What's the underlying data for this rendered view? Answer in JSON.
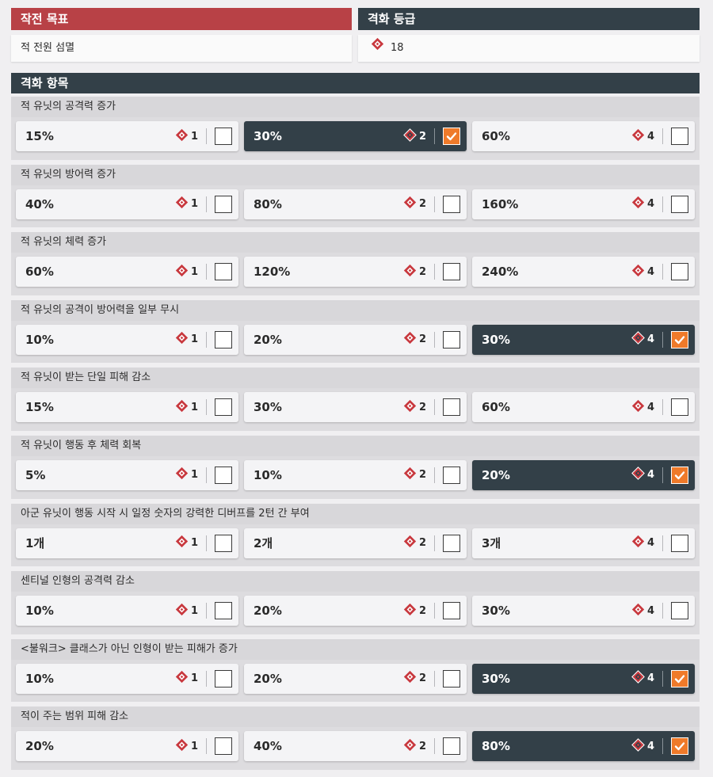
{
  "objective": {
    "header": "작전 목표",
    "value": "적 전원 섬멸"
  },
  "grade": {
    "header": "격화 등급",
    "value": "18",
    "icon": "diamond-arrow-icon"
  },
  "modifiers_header": "격화 항목",
  "colors": {
    "accent_red": "#b84146",
    "dark": "#334048",
    "check": "#ef7a2a",
    "icon_red": "#c8383e"
  },
  "modifiers": [
    {
      "title": "적 유닛의 공격력 증가",
      "options": [
        {
          "value": "15%",
          "cost": "1",
          "checked": false
        },
        {
          "value": "30%",
          "cost": "2",
          "checked": true
        },
        {
          "value": "60%",
          "cost": "4",
          "checked": false
        }
      ]
    },
    {
      "title": "적 유닛의 방어력 증가",
      "options": [
        {
          "value": "40%",
          "cost": "1",
          "checked": false
        },
        {
          "value": "80%",
          "cost": "2",
          "checked": false
        },
        {
          "value": "160%",
          "cost": "4",
          "checked": false
        }
      ]
    },
    {
      "title": "적 유닛의 체력 증가",
      "options": [
        {
          "value": "60%",
          "cost": "1",
          "checked": false
        },
        {
          "value": "120%",
          "cost": "2",
          "checked": false
        },
        {
          "value": "240%",
          "cost": "4",
          "checked": false
        }
      ]
    },
    {
      "title": "적 유닛의 공격이 방어력을 일부 무시",
      "options": [
        {
          "value": "10%",
          "cost": "1",
          "checked": false
        },
        {
          "value": "20%",
          "cost": "2",
          "checked": false
        },
        {
          "value": "30%",
          "cost": "4",
          "checked": true
        }
      ]
    },
    {
      "title": "적 유닛이 받는 단일 피해 감소",
      "options": [
        {
          "value": "15%",
          "cost": "1",
          "checked": false
        },
        {
          "value": "30%",
          "cost": "2",
          "checked": false
        },
        {
          "value": "60%",
          "cost": "4",
          "checked": false
        }
      ]
    },
    {
      "title": "적 유닛이 행동 후 체력 회복",
      "options": [
        {
          "value": "5%",
          "cost": "1",
          "checked": false
        },
        {
          "value": "10%",
          "cost": "2",
          "checked": false
        },
        {
          "value": "20%",
          "cost": "4",
          "checked": true
        }
      ]
    },
    {
      "title": "아군 유닛이 행동 시작 시 일정 숫자의 강력한 디버프를 2턴 간 부여",
      "options": [
        {
          "value": "1개",
          "cost": "1",
          "checked": false
        },
        {
          "value": "2개",
          "cost": "2",
          "checked": false
        },
        {
          "value": "3개",
          "cost": "4",
          "checked": false
        }
      ]
    },
    {
      "title": "센티널 인형의 공격력 감소",
      "options": [
        {
          "value": "10%",
          "cost": "1",
          "checked": false
        },
        {
          "value": "20%",
          "cost": "2",
          "checked": false
        },
        {
          "value": "30%",
          "cost": "4",
          "checked": false
        }
      ]
    },
    {
      "title": "<불워크> 클래스가 아닌 인형이 받는 피해가 증가",
      "options": [
        {
          "value": "10%",
          "cost": "1",
          "checked": false
        },
        {
          "value": "20%",
          "cost": "2",
          "checked": false
        },
        {
          "value": "30%",
          "cost": "4",
          "checked": true
        }
      ]
    },
    {
      "title": "적이 주는 범위 피해 감소",
      "options": [
        {
          "value": "20%",
          "cost": "1",
          "checked": false
        },
        {
          "value": "40%",
          "cost": "2",
          "checked": false
        },
        {
          "value": "80%",
          "cost": "4",
          "checked": true
        }
      ]
    }
  ]
}
